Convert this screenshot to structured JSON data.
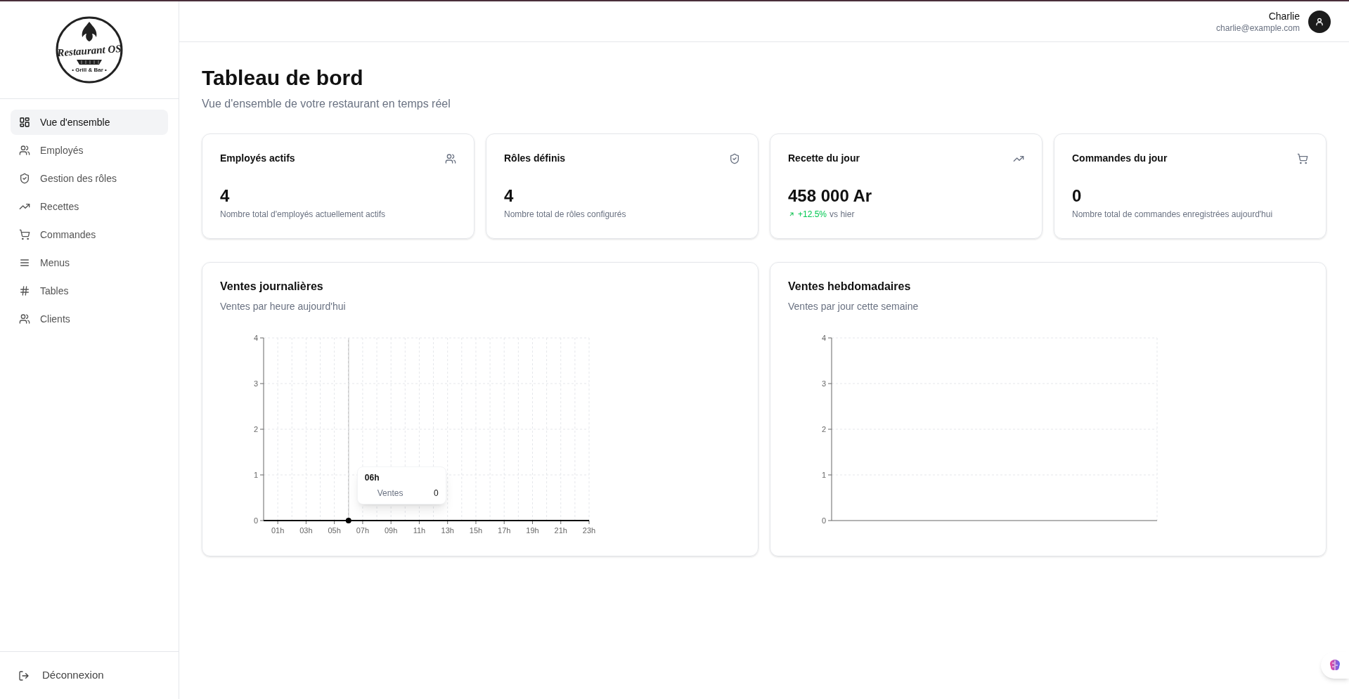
{
  "logo": {
    "name": "Restaurant OS",
    "tagline": "• Grill & Bar •"
  },
  "sidebar": {
    "items": [
      {
        "label": "Vue d'ensemble",
        "selected": true
      },
      {
        "label": "Employés",
        "selected": false
      },
      {
        "label": "Gestion des rôles",
        "selected": false
      },
      {
        "label": "Recettes",
        "selected": false
      },
      {
        "label": "Commandes",
        "selected": false
      },
      {
        "label": "Menus",
        "selected": false
      },
      {
        "label": "Tables",
        "selected": false
      },
      {
        "label": "Clients",
        "selected": false
      }
    ],
    "logout": "Déconnexion"
  },
  "user": {
    "name": "Charlie",
    "email": "charlie@example.com"
  },
  "page": {
    "title": "Tableau de bord",
    "subtitle": "Vue d'ensemble de votre restaurant en temps réel"
  },
  "stats": [
    {
      "title": "Employés actifs",
      "value": "4",
      "description": "Nombre total d'employés actuellement actifs"
    },
    {
      "title": "Rôles définis",
      "value": "4",
      "description": "Nombre total de rôles configurés"
    },
    {
      "title": "Recette du jour",
      "value": "458 000 Ar",
      "trend": {
        "change": "+12.5%",
        "label": "vs hier"
      }
    },
    {
      "title": "Commandes du jour",
      "value": "0",
      "description": "Nombre total de commandes enregistrées aujourd'hui"
    }
  ],
  "charts": [
    {
      "title": "Ventes journalières",
      "subtitle": "Ventes par heure aujourd'hui",
      "tooltip": {
        "title": "06h",
        "value": "0"
      },
      "chart_data": {
        "type": "line",
        "grid": true,
        "categories": [
          null,
          "01h",
          null,
          "03h",
          null,
          "05h",
          null,
          "07h",
          null,
          "09h",
          null,
          "11h",
          null,
          "13h",
          null,
          "15h",
          null,
          "17h",
          null,
          "19h",
          null,
          "21h",
          null,
          "23h"
        ],
        "series": [
          {
            "name": "Ventes",
            "color": "#000000",
            "values": [
              0,
              0,
              0,
              0,
              0,
              0,
              0,
              0,
              0,
              0,
              0,
              0,
              0,
              0,
              0,
              0,
              0,
              0,
              0,
              0,
              0,
              0,
              0,
              0
            ]
          }
        ],
        "ylim": [
          0,
          4
        ],
        "yticks": [
          0,
          1,
          2,
          3,
          4
        ]
      }
    },
    {
      "title": "Ventes hebdomadaires",
      "subtitle": "Ventes par jour cette semaine",
      "chart_data": {
        "type": "line",
        "grid": true,
        "categories": [
          null,
          null,
          null,
          null,
          null,
          null,
          null
        ],
        "ylim": [
          0,
          4
        ],
        "yticks": [
          0,
          1,
          2,
          3,
          4
        ]
      }
    }
  ]
}
